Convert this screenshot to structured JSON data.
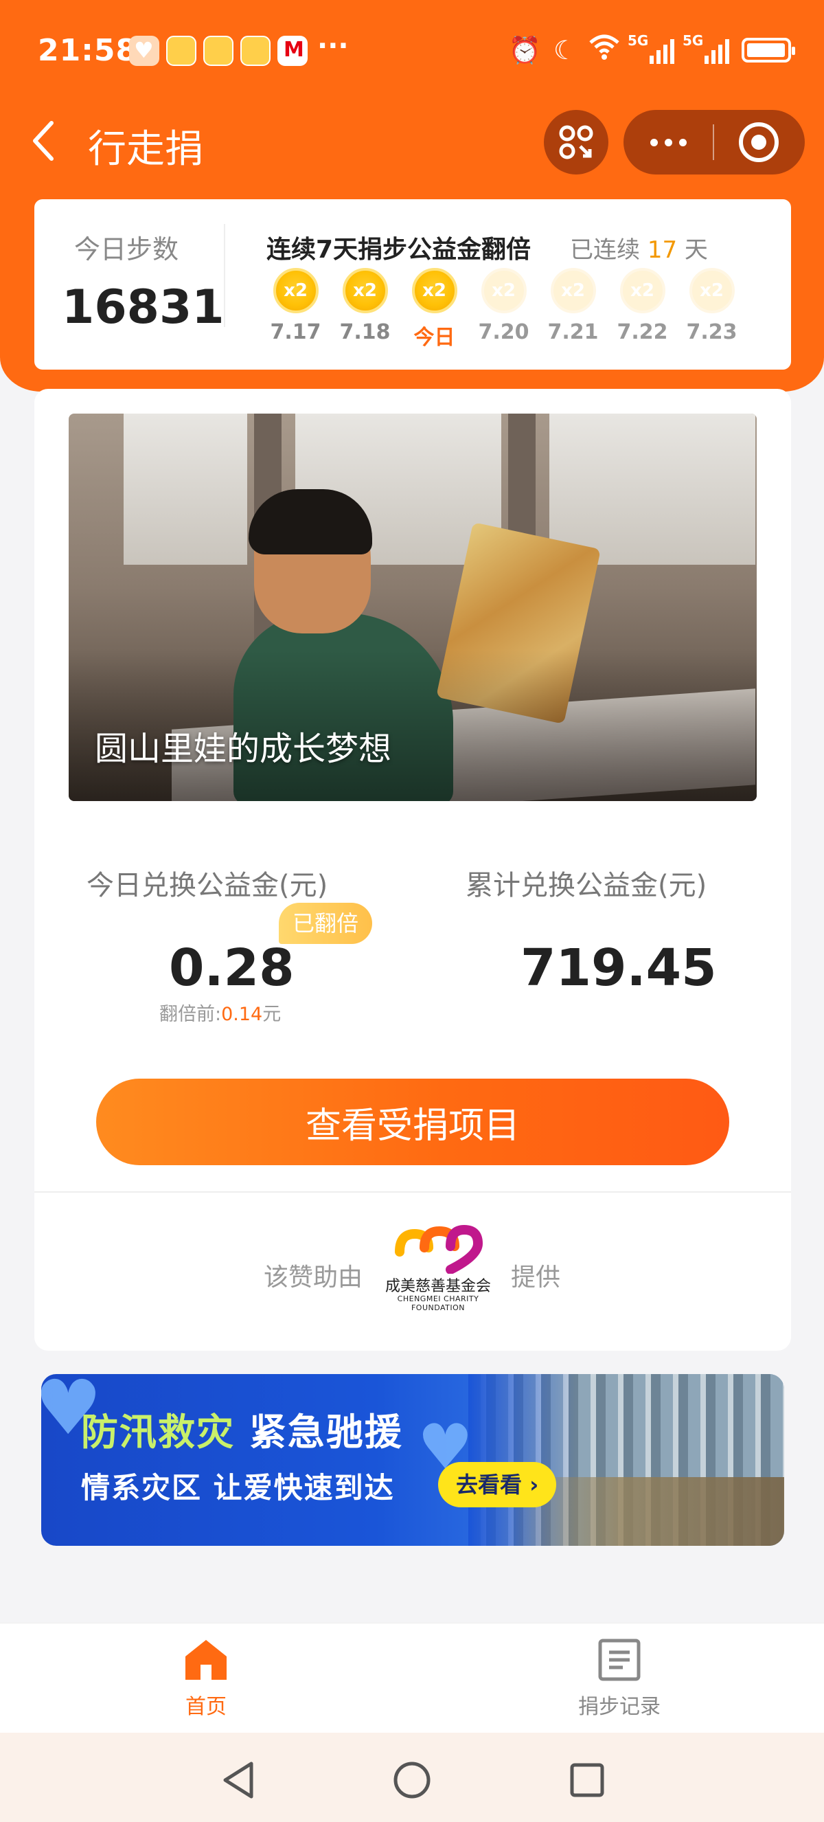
{
  "status_bar": {
    "time": "21:58",
    "more": "···",
    "network_1": "5G",
    "network_2": "5G"
  },
  "nav": {
    "title": "行走捐"
  },
  "steps": {
    "label": "今日步数",
    "value": "16831"
  },
  "streak": {
    "title": "连续7天捐步公益金翻倍",
    "prefix": "已连续",
    "days": "17",
    "suffix": "天",
    "multiplier": "x2",
    "dates": [
      "7.17",
      "7.18",
      "今日",
      "7.20",
      "7.21",
      "7.22",
      "7.23"
    ],
    "completed_count": 3
  },
  "project": {
    "caption": "圆山里娃的成长梦想"
  },
  "fund": {
    "today_label": "今日兑换公益金(元)",
    "doubled_badge": "已翻倍",
    "today_value": "0.28",
    "before_prefix": "翻倍前:",
    "before_value": "0.14",
    "before_unit": "元",
    "total_label": "累计兑换公益金(元)",
    "total_value": "719.45"
  },
  "actions": {
    "view_projects": "查看受捐项目"
  },
  "sponsor": {
    "prefix": "该赞助由",
    "name": "成美慈善基金会",
    "name_en": "CHENGMEI CHARITY FOUNDATION",
    "suffix": "提供"
  },
  "banner": {
    "title_part1": "防汛救灾",
    "title_part2": "紧急驰援",
    "subtitle": "情系灾区 让爱快速到达",
    "button": "去看看 ›"
  },
  "tabs": {
    "home": "首页",
    "records": "捐步记录"
  },
  "colors": {
    "brand_orange": "#ff6a12",
    "coin_gold": "#ffc107",
    "banner_blue": "#1a55d8"
  }
}
